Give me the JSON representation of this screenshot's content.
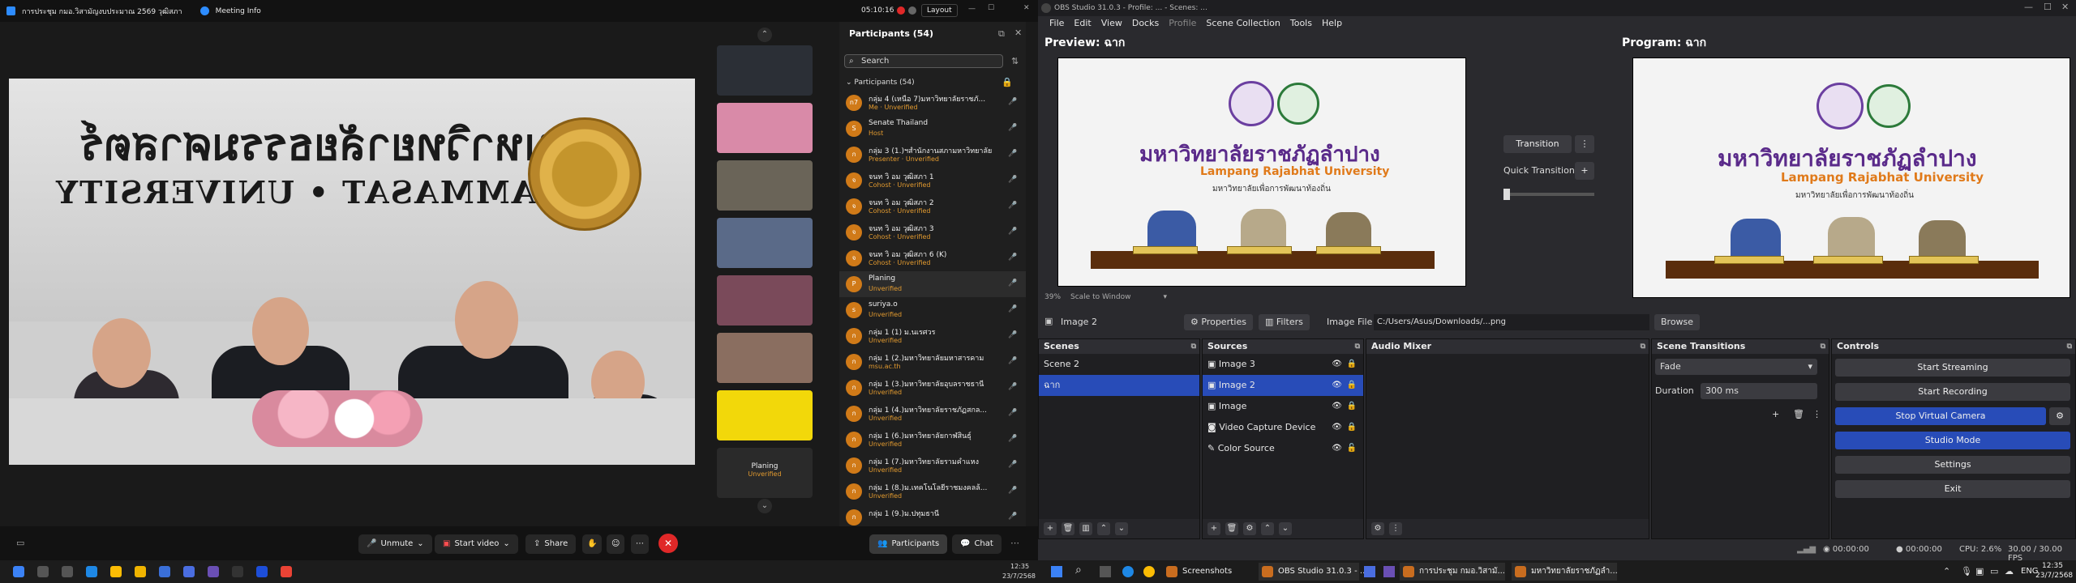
{
  "zoom": {
    "title": "การประชุม กมอ.วิสามัญงบประมาณ 2569 วุฒิสภา",
    "meeting_info": "Meeting Info",
    "timer": "05:10:16",
    "layout_label": "Layout",
    "stage": {
      "wall_text_th": "มหาวิทยาลัยธรรมศาสตร์",
      "wall_text_en": "THAMMASAT • UNIVERSITY"
    },
    "filmstrip": [
      {
        "label": ""
      },
      {
        "label": ""
      },
      {
        "label": ""
      },
      {
        "label": ""
      },
      {
        "label": ""
      },
      {
        "label": ""
      },
      {
        "label": ""
      }
    ],
    "filmstrip_tile": {
      "name": "Planing",
      "status": "Unverified"
    },
    "controls": {
      "unmute": "Unmute",
      "start_video": "Start video",
      "share": "Share",
      "participants": "Participants",
      "chat": "Chat"
    },
    "participants_panel": {
      "title": "Participants (54)",
      "search_placeholder": "Search",
      "group_label": "Participants (54)",
      "items": [
        {
          "avatar": "n7",
          "name": "กลุ่ม 4 (เหนือ 7)มหาวิทยาลัยราชภั...",
          "status": "Me · Unverified"
        },
        {
          "avatar": "S",
          "name": "Senate Thailand",
          "status": "Host"
        },
        {
          "avatar": "ก",
          "name": "กลุ่ม 3 (1.)ฯสำนักงานสภามหาวิทยาลัย",
          "status": "Presenter · Unverified"
        },
        {
          "avatar": "จ",
          "name": "จนท วิ อม วุฒิสภา 1",
          "status": "Cohost · Unverified"
        },
        {
          "avatar": "จ",
          "name": "จนท วิ อม วุฒิสภา 2",
          "status": "Cohost · Unverified"
        },
        {
          "avatar": "จ",
          "name": "จนท วิ อม วุฒิสภา 3",
          "status": "Cohost · Unverified"
        },
        {
          "avatar": "จ",
          "name": "จนท วิ อม วุฒิสภา 6 (K)",
          "status": "Cohost · Unverified"
        },
        {
          "avatar": "P",
          "name": "Planing",
          "status": "Unverified"
        },
        {
          "avatar": "s",
          "name": "suriya.o",
          "status": "Unverified"
        },
        {
          "avatar": "ก",
          "name": "กลุ่ม 1 (1) ม.นเรศวร",
          "status": "Unverified"
        },
        {
          "avatar": "ก",
          "name": "กลุ่ม 1 (2.)มหาวิทยาลัยมหาสารคาม",
          "status": "msu.ac.th"
        },
        {
          "avatar": "ก",
          "name": "กลุ่ม 1 (3.)มหาวิทยาลัยอุบลราชธานี",
          "status": "Unverified"
        },
        {
          "avatar": "ก",
          "name": "กลุ่ม 1 (4.)มหาวิทยาลัยราชภัฏสกล...",
          "status": "Unverified"
        },
        {
          "avatar": "ก",
          "name": "กลุ่ม 1 (6.)มหาวิทยาลัยกาฬสินธุ์",
          "status": "Unverified"
        },
        {
          "avatar": "ก",
          "name": "กลุ่ม 1 (7.)มหาวิทยาลัยรามคำแหง",
          "status": "Unverified"
        },
        {
          "avatar": "ก",
          "name": "กลุ่ม 1 (8.)ม.เทคโนโลยีราชมงคลล้...",
          "status": "Unverified"
        },
        {
          "avatar": "ก",
          "name": "กลุ่ม 1 (9.)ม.ปทุมธานี",
          "status": ""
        }
      ]
    }
  },
  "taskbar_left": {
    "time": "12:35",
    "date": "23/7/2568"
  },
  "obs": {
    "title": "OBS Studio 31.0.3 - Profile: ...  - Scenes: ...",
    "menu": [
      "File",
      "Edit",
      "View",
      "Docks",
      "Profile",
      "Scene Collection",
      "Tools",
      "Help"
    ],
    "preview_label": "Preview: ฉาก",
    "program_label": "Program: ฉาก",
    "screen": {
      "th": "มหาวิทยาลัยราชภัฏลำปาง",
      "en": "Lampang Rajabhat University",
      "sub": "มหาวิทยาลัยเพื่อการพัฒนาท้องถิ่น"
    },
    "zoom_pct": "39%",
    "scale_label": "Scale to Window",
    "transition_btn": "Transition",
    "quick_transitions": "Quick Transitions",
    "selected_source": "Image 2",
    "properties": "Properties",
    "filters": "Filters",
    "image_file_label": "Image File",
    "image_file_path": "C:/Users/Asus/Downloads/...png",
    "browse": "Browse",
    "docks": {
      "scenes": "Scenes",
      "sources": "Sources",
      "audio_mixer": "Audio Mixer",
      "scene_transitions": "Scene Transitions",
      "controls": "Controls"
    },
    "scenes": [
      "Scene 2",
      "ฉาก"
    ],
    "sources": [
      "Image 3",
      "Image 2",
      "Image",
      "Video Capture Device",
      "Color Source"
    ],
    "transition_type": "Fade",
    "duration_label": "Duration",
    "duration_value": "300 ms",
    "control_buttons": [
      "Start Streaming",
      "Start Recording",
      "Stop Virtual Camera",
      "Studio Mode",
      "Settings",
      "Exit"
    ],
    "status": {
      "rec_time": "00:00:00",
      "stream_time": "00:00:00",
      "cpu": "CPU: 2.6%",
      "fps": "30.00 / 30.00 FPS"
    }
  },
  "taskbar_right": {
    "apps": [
      "Screenshots",
      "OBS Studio 31.0.3 - ...",
      "การประชุม กมอ.วิสามั...",
      "มหาวิทยาลัยราชภัฏลำ..."
    ],
    "lang": "ENG",
    "time": "12:35",
    "date": "23/7/2568"
  }
}
